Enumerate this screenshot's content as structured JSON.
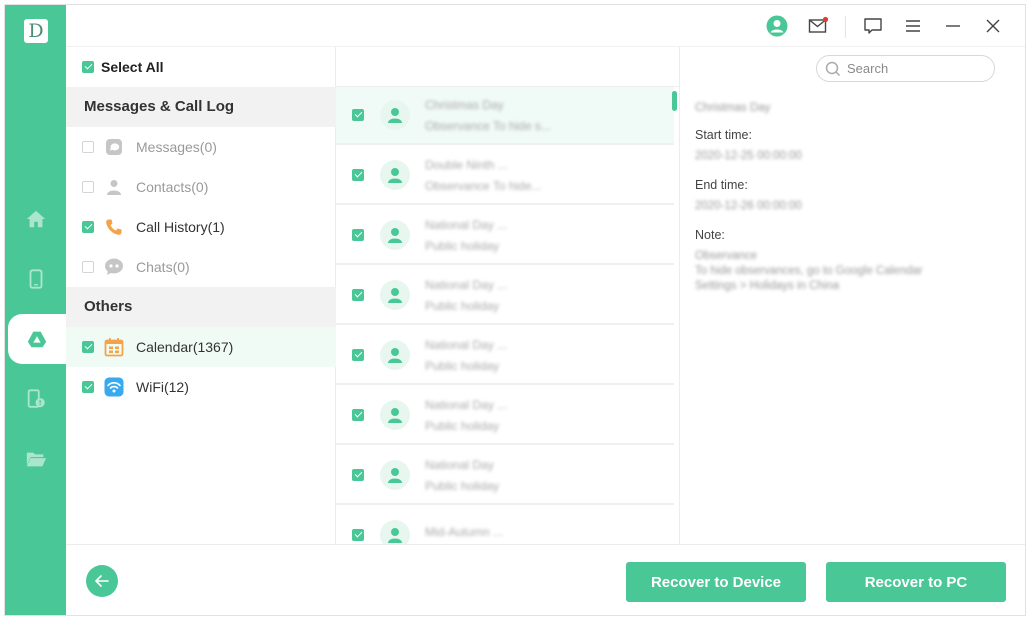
{
  "app": {
    "logo_letter": "D"
  },
  "colors": {
    "accent": "#4ac797",
    "calendar": "#f5a34a",
    "wifi": "#39a9f0",
    "call": "#f5a34a"
  },
  "rail": {
    "items": [
      {
        "icon": "home-icon",
        "active": false
      },
      {
        "icon": "phone-device-icon",
        "active": false
      },
      {
        "icon": "google-drive-icon",
        "active": true
      },
      {
        "icon": "device-repair-icon",
        "active": false
      },
      {
        "icon": "folder-icon",
        "active": false
      }
    ]
  },
  "topbar": {
    "icons": [
      "account-icon",
      "mail-icon",
      "feedback-icon",
      "menu-icon",
      "minimize-icon",
      "close-icon"
    ]
  },
  "categories": {
    "select_all": "Select All",
    "groups": [
      {
        "title": "Messages & Call Log",
        "items": [
          {
            "label": "Messages(0)",
            "checked": false,
            "enabled": false,
            "icon": "message-icon"
          },
          {
            "label": "Contacts(0)",
            "checked": false,
            "enabled": false,
            "icon": "contact-icon"
          },
          {
            "label": "Call History(1)",
            "checked": true,
            "enabled": true,
            "icon": "phone-icon"
          },
          {
            "label": "Chats(0)",
            "checked": false,
            "enabled": false,
            "icon": "chat-icon"
          }
        ]
      },
      {
        "title": "Others",
        "items": [
          {
            "label": "Calendar(1367)",
            "checked": true,
            "enabled": true,
            "selected": true,
            "icon": "calendar-icon"
          },
          {
            "label": "WiFi(12)",
            "checked": true,
            "enabled": true,
            "icon": "wifi-icon"
          }
        ]
      }
    ]
  },
  "search": {
    "placeholder": "Search",
    "value": ""
  },
  "list": {
    "items": [
      {
        "title": "Christmas Day",
        "subtitle": "Observance To hide s...",
        "checked": true,
        "selected": true
      },
      {
        "title": "Double Ninth ...",
        "subtitle": "Observance To hide...",
        "checked": true
      },
      {
        "title": "National Day ...",
        "subtitle": "Public holiday",
        "checked": true
      },
      {
        "title": "National Day ...",
        "subtitle": "Public holiday",
        "checked": true
      },
      {
        "title": "National Day ...",
        "subtitle": "Public holiday",
        "checked": true
      },
      {
        "title": "National Day ...",
        "subtitle": "Public holiday",
        "checked": true
      },
      {
        "title": "National Day",
        "subtitle": "Public holiday",
        "checked": true
      },
      {
        "title": "Mid-Autumn ...",
        "subtitle": "",
        "checked": true
      }
    ]
  },
  "detail": {
    "title": "Christmas Day",
    "start_label": "Start time:",
    "start_value": "2020-12-25 00:00:00",
    "end_label": "End time:",
    "end_value": "2020-12-26 00:00:00",
    "note_label": "Note:",
    "note_lines": [
      "Observance",
      "To hide observances, go to Google Calendar",
      "Settings > Holidays in China"
    ]
  },
  "footer": {
    "recover_device": "Recover to Device",
    "recover_pc": "Recover to PC"
  }
}
